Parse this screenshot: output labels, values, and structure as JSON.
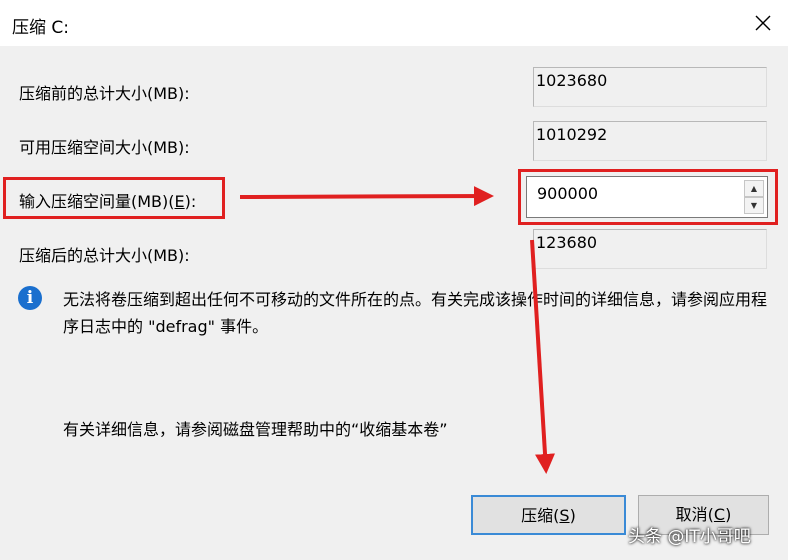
{
  "window": {
    "title": "压缩 C:"
  },
  "fields": {
    "total_before_label": "压缩前的总计大小(MB):",
    "total_before_value": "1023680",
    "available_label": "可用压缩空间大小(MB):",
    "available_value": "1010292",
    "shrink_amount_label_text": "输入压缩空间量(MB)(",
    "shrink_amount_label_key": "E",
    "shrink_amount_label_end": "):",
    "shrink_amount_value": "900000",
    "total_after_label": "压缩后的总计大小(MB):",
    "total_after_value": "123680"
  },
  "info": {
    "icon": "info-icon",
    "message": "无法将卷压缩到超出任何不可移动的文件所在的点。有关完成该操作时间的详细信息，请参阅应用程序日志中的 \"defrag\" 事件。",
    "more_info": "有关详细信息，请参阅磁盘管理帮助中的“收缩基本卷”"
  },
  "buttons": {
    "shrink_text": "压缩(",
    "shrink_key": "S",
    "shrink_end": ")",
    "cancel_text": "取消(",
    "cancel_key": "C",
    "cancel_end": ")"
  },
  "annotation": {
    "color": "#e02020"
  },
  "watermark": {
    "text": "头条 @IT小哥吧"
  }
}
